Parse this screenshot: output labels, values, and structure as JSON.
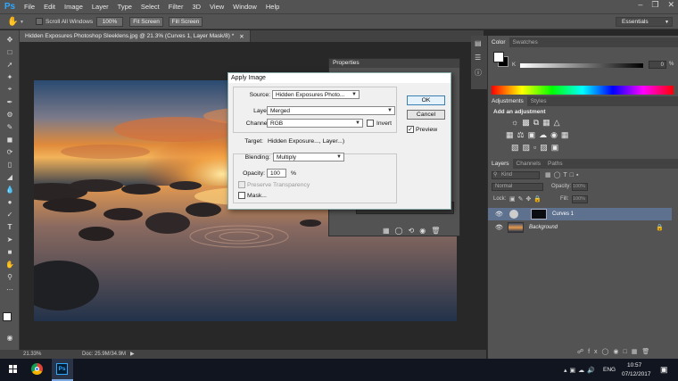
{
  "app": {
    "logo": "Ps"
  },
  "menu": [
    "File",
    "Edit",
    "Image",
    "Layer",
    "Type",
    "Select",
    "Filter",
    "3D",
    "View",
    "Window",
    "Help"
  ],
  "options_bar": {
    "scroll_all_windows": "Scroll All Windows",
    "zoom_100": "100%",
    "fit_screen": "Fit Screen",
    "fill_screen": "Fill Screen",
    "workspace": "Essentials"
  },
  "document": {
    "tab_title": "Hidden Exposures Photoshop Sleeklens.jpg @ 21.3% (Curves 1, Layer Mask/8) *",
    "zoom": "21.33%",
    "doc_size": "Doc: 25.9M/34.9M"
  },
  "panels": {
    "color_tabs": [
      "Color",
      "Swatches"
    ],
    "color_k_label": "K",
    "color_k_value": "0",
    "color_k_unit": "%",
    "adjustments_tabs": [
      "Adjustments",
      "Styles"
    ],
    "add_adjustment": "Add an adjustment",
    "layers_tabs": [
      "Layers",
      "Channels",
      "Paths"
    ],
    "kind_filter": "Kind",
    "blend_mode": "Normal",
    "opacity_label": "Opacity:",
    "opacity_value": "100%",
    "lock_label": "Lock:",
    "fill_label": "Fill:",
    "fill_value": "100%",
    "layers": [
      {
        "name": "Curves 1"
      },
      {
        "name": "Background"
      }
    ],
    "properties_title": "Properties"
  },
  "dialog": {
    "title": "Apply Image",
    "source_label": "Source:",
    "source_value": "Hidden Exposures Photo...",
    "layer_label": "Layer:",
    "layer_value": "Merged",
    "channel_label": "Channel:",
    "channel_value": "RGB",
    "invert_label": "Invert",
    "target_label": "Target:",
    "target_value": "Hidden Exposure..., Layer...)",
    "blending_label": "Blending:",
    "blending_value": "Multiply",
    "opacity_label": "Opacity:",
    "opacity_value": "100",
    "opacity_unit": "%",
    "preserve_label": "Preserve Transparency",
    "mask_label": "Mask...",
    "ok_label": "OK",
    "cancel_label": "Cancel",
    "preview_label": "Preview"
  },
  "taskbar": {
    "time": "10:57",
    "date": "07/12/2017",
    "language": "ENG"
  }
}
